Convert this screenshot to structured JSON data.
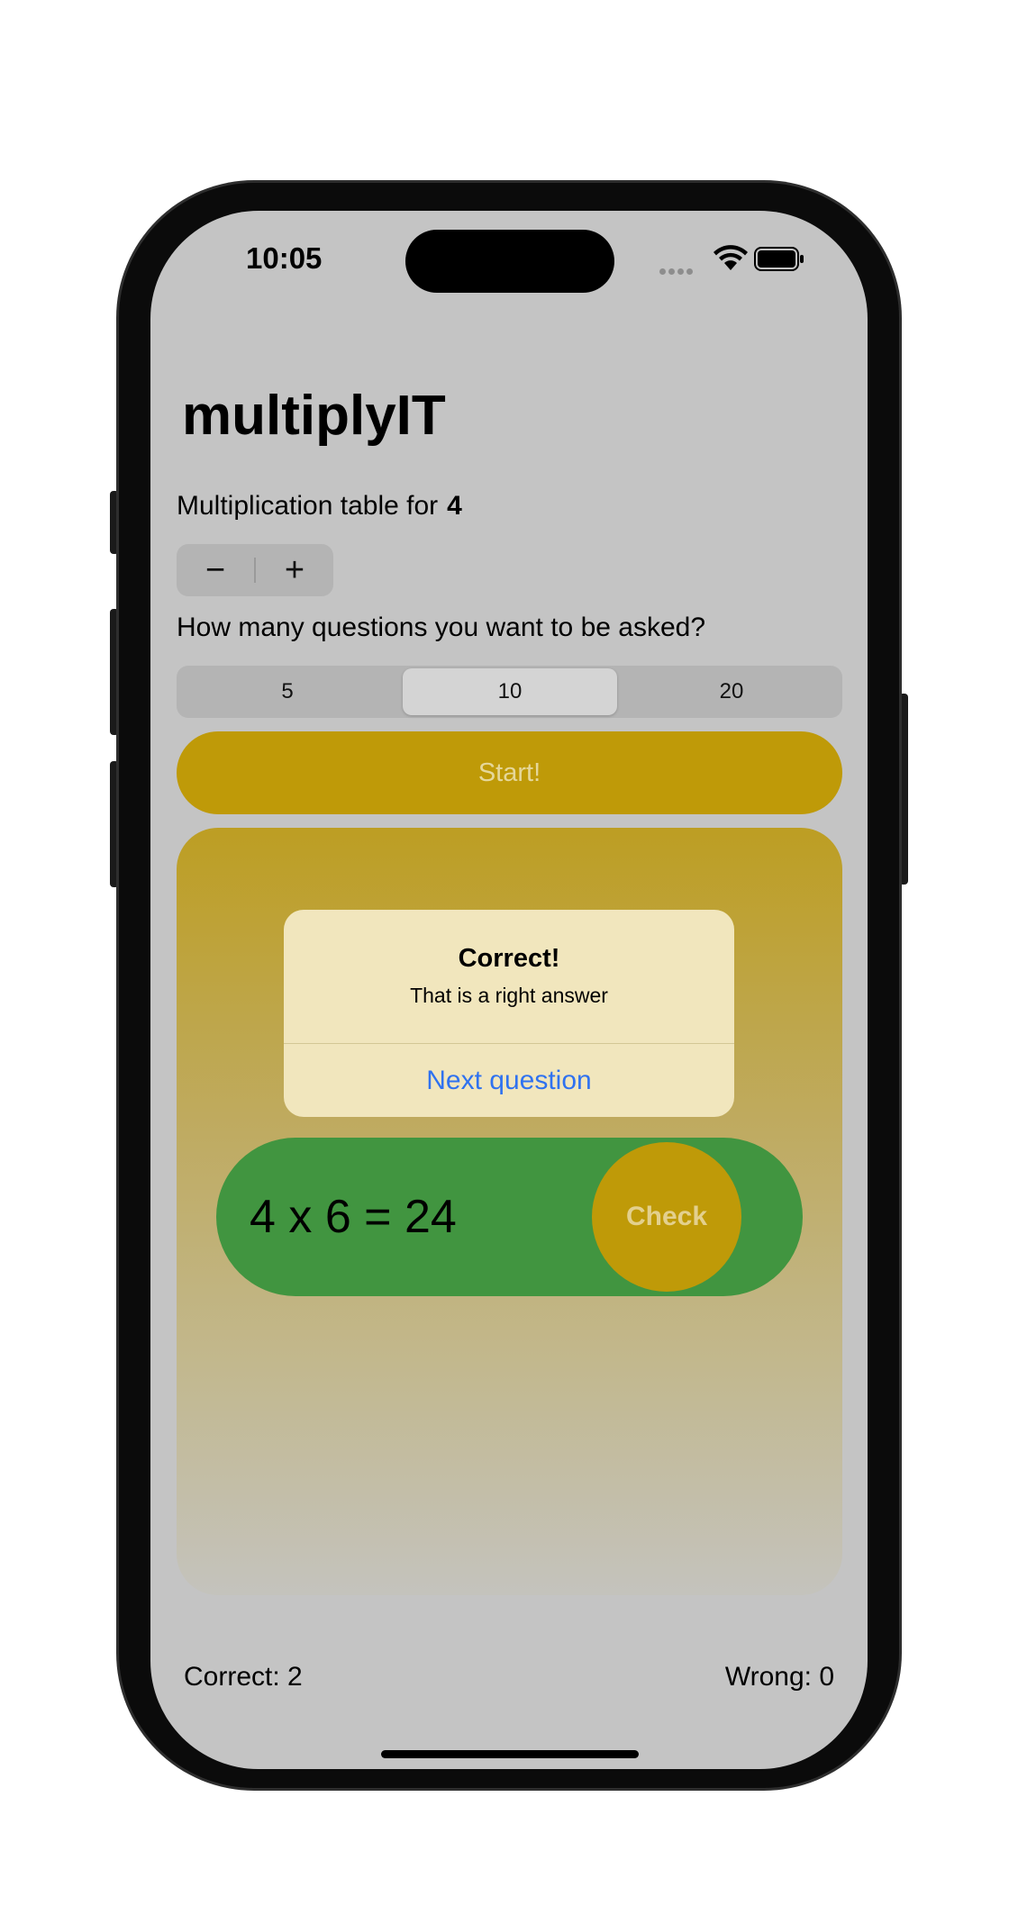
{
  "status_bar": {
    "time": "10:05"
  },
  "app": {
    "title": "multiplyIT"
  },
  "multiplication": {
    "label": "Multiplication table for",
    "value": "4"
  },
  "stepper": {
    "minus_label": "−",
    "plus_label": "+"
  },
  "questions": {
    "label": "How many questions you want to be asked?",
    "options": [
      "5",
      "10",
      "20"
    ],
    "selected": "10"
  },
  "start_button": {
    "label": "Start!"
  },
  "alert": {
    "title": "Correct!",
    "message": "That is a right answer",
    "button_label": "Next question"
  },
  "question_card": {
    "equation": "4 x 6 = 24",
    "check_label": "Check"
  },
  "score": {
    "correct": "Correct: 2",
    "wrong": "Wrong: 0"
  },
  "colors": {
    "accent_gold": "#bf9a08",
    "answer_green": "#419540",
    "alert_link_blue": "#2f72f0",
    "screen_background": "#c4c4c4"
  }
}
